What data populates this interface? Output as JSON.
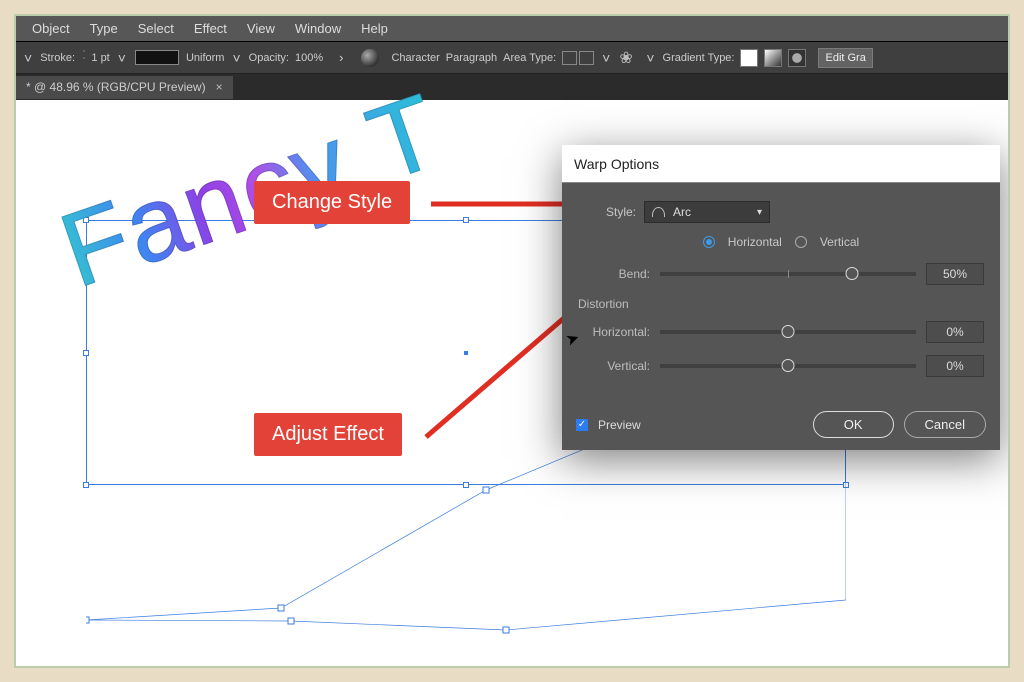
{
  "menu": {
    "items": [
      "Object",
      "Type",
      "Select",
      "Effect",
      "View",
      "Window",
      "Help"
    ]
  },
  "controlbar": {
    "labels": {
      "stroke": "Stroke:",
      "strokeVal": "1 pt",
      "uniform": "Uniform",
      "opacity": "Opacity:",
      "opacityVal": "100%",
      "character": "Character",
      "paragraph": "Paragraph",
      "areaType": "Area Type:",
      "gradientType": "Gradient Type:",
      "editGrad": "Edit Gra"
    }
  },
  "tab": {
    "label": "* @ 48.96 % (RGB/CPU Preview)"
  },
  "canvas": {
    "text": "Fancy T"
  },
  "anno": {
    "changeStyle": "Change Style",
    "adjustEffect": "Adjust Effect"
  },
  "dialog": {
    "title": "Warp Options",
    "styleLabel": "Style:",
    "styleValue": "Arc",
    "orientation": {
      "horizontal": "Horizontal",
      "vertical": "Vertical"
    },
    "bend": {
      "label": "Bend:",
      "value": "50%"
    },
    "distortion": {
      "header": "Distortion",
      "horizontal": {
        "label": "Horizontal:",
        "value": "0%"
      },
      "vertical": {
        "label": "Vertical:",
        "value": "0%"
      }
    },
    "preview": "Preview",
    "ok": "OK",
    "cancel": "Cancel"
  }
}
